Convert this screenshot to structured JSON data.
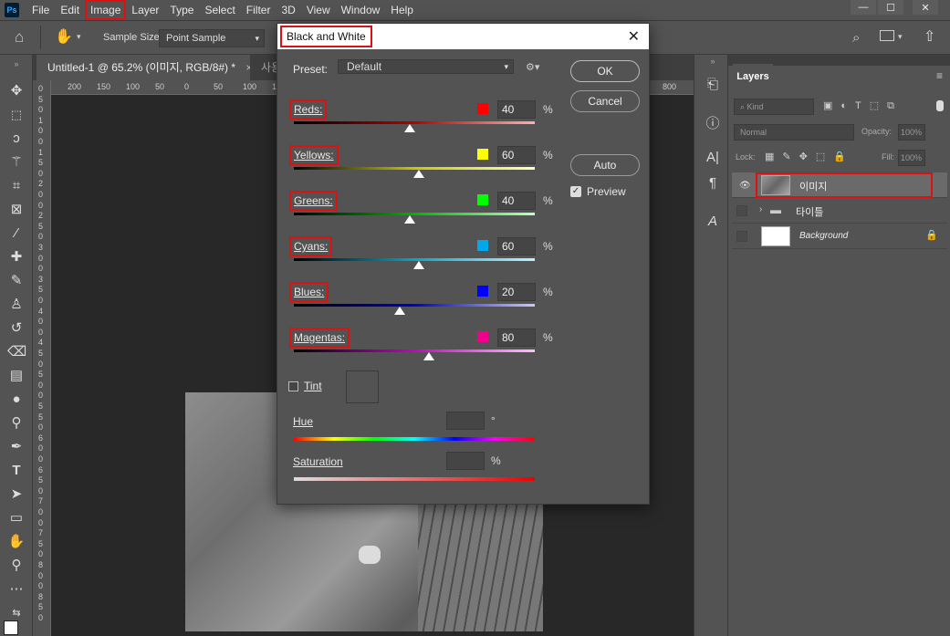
{
  "menubar": {
    "logo": "Ps",
    "items": [
      "File",
      "Edit",
      "Image",
      "Layer",
      "Type",
      "Select",
      "Filter",
      "3D",
      "View",
      "Window",
      "Help"
    ],
    "win_minimize": "—",
    "win_maximize": "☐",
    "win_close": "✕"
  },
  "options": {
    "sample_size_label": "Sample Size:",
    "sample_size_value": "Point Sample"
  },
  "tabs": {
    "doc_tab": "Untitled-1 @ 65.2% (이미지, RGB/8#) *",
    "doc_tab_close": "×",
    "doc_tab2": "사용"
  },
  "rulers": {
    "top": [
      "200",
      "150",
      "100",
      "50",
      "0",
      "50",
      "100",
      "150",
      "800"
    ],
    "left": [
      "0",
      "5",
      "0",
      "1",
      "0",
      "0",
      "1",
      "5",
      "0",
      "2",
      "0",
      "0",
      "2",
      "5",
      "0",
      "3",
      "0",
      "0",
      "3",
      "5",
      "0",
      "4",
      "0",
      "0",
      "4",
      "5",
      "0",
      "5",
      "0",
      "0",
      "5",
      "5",
      "0",
      "6",
      "0",
      "0",
      "6",
      "5",
      "0",
      "7",
      "0",
      "0",
      "7",
      "5",
      "0",
      "8",
      "0",
      "0",
      "8",
      "5",
      "0"
    ]
  },
  "dialog": {
    "title": "Black and White",
    "close": "✕",
    "preset_label": "Preset:",
    "preset_value": "Default",
    "ok": "OK",
    "cancel": "Cancel",
    "auto": "Auto",
    "preview_label": "Preview",
    "preview_checked": true,
    "percent": "%",
    "sliders": [
      {
        "label": "Reds:",
        "color": "#ff0000",
        "value": "40",
        "gradient": "linear-gradient(90deg,#000,#b40000,#ffb0b0)",
        "fraction": 0.48
      },
      {
        "label": "Yellows:",
        "color": "#ffff00",
        "value": "60",
        "gradient": "linear-gradient(90deg,#000,#c8c800,#ffffc0)",
        "fraction": 0.52
      },
      {
        "label": "Greens:",
        "color": "#00ff00",
        "value": "40",
        "gradient": "linear-gradient(90deg,#000,#00b400,#c0ffc0)",
        "fraction": 0.48
      },
      {
        "label": "Cyans:",
        "color": "#00a8e8",
        "value": "60",
        "gradient": "linear-gradient(90deg,#000,#00a8c8,#c0f0ff)",
        "fraction": 0.52
      },
      {
        "label": "Blues:",
        "color": "#0000ff",
        "value": "20",
        "gradient": "linear-gradient(90deg,#000,#0000c8,#c8c8ff)",
        "fraction": 0.44
      },
      {
        "label": "Magentas:",
        "color": "#f0008c",
        "value": "80",
        "gradient": "linear-gradient(90deg,#000,#c800c8,#ffc0ff)",
        "fraction": 0.56
      }
    ],
    "tint_label": "Tint",
    "hue_label": "Hue",
    "hue_unit": "°",
    "saturation_label": "Saturation",
    "saturation_unit": "%"
  },
  "layers": {
    "tab": "Layers",
    "kind_placeholder": "Kind",
    "blend_mode": "Normal",
    "opacity_label": "Opacity:",
    "opacity_value": "100%",
    "lock_label": "Lock:",
    "fill_label": "Fill:",
    "fill_value": "100%",
    "rows": [
      {
        "name": "이미지",
        "visible": true,
        "selected": true
      },
      {
        "name": "타이틀",
        "visible": false,
        "selected": false,
        "group": true
      },
      {
        "name": "Background",
        "visible": false,
        "selected": false,
        "locked": true
      }
    ]
  }
}
